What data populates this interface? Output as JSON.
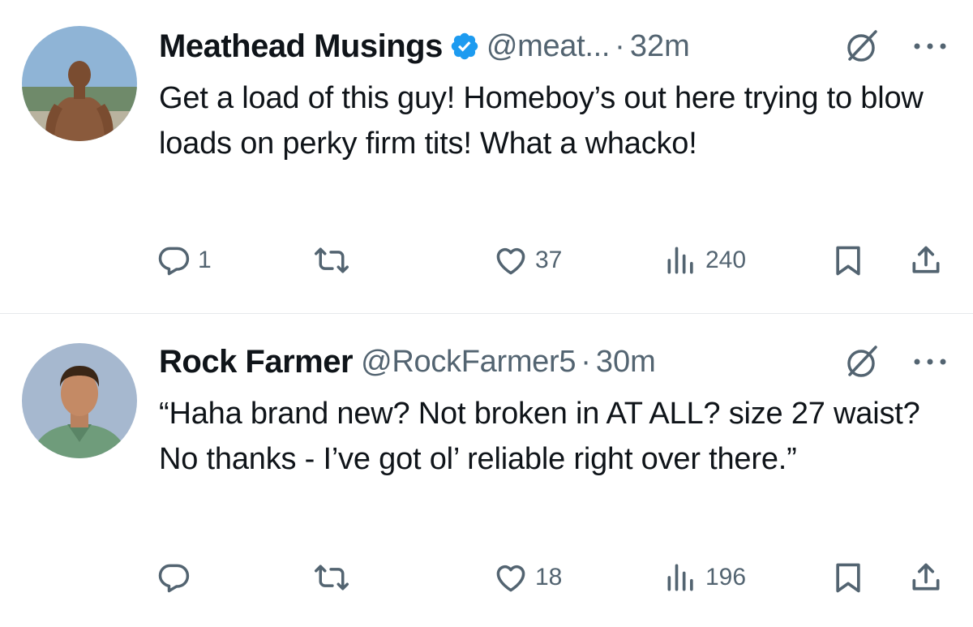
{
  "tweets": [
    {
      "name": "Meathead Musings",
      "verified": true,
      "handle": "@meat...",
      "dot": "·",
      "time": "32m",
      "text": "Get a load of this guy! Homeboy’s out here trying to blow loads on perky firm tits! What a whacko!",
      "replies": "1",
      "reposts": "",
      "likes": "37",
      "views": "240"
    },
    {
      "name": "Rock Farmer",
      "verified": false,
      "handle": "@RockFarmer5",
      "dot": "·",
      "time": "30m",
      "text": "“Haha brand new? Not broken in AT ALL? size 27 waist? No thanks - I’ve got ol’ reliable right over there.”",
      "replies": "",
      "reposts": "",
      "likes": "18",
      "views": "196"
    }
  ],
  "colors": {
    "text": "#0f1419",
    "secondary": "#536471",
    "verified": "#1d9bf0",
    "divider": "#e6e9ec"
  },
  "icons": [
    "reply-icon",
    "repost-icon",
    "like-icon",
    "views-icon",
    "bookmark-icon",
    "share-icon",
    "grok-icon",
    "more-icon",
    "verified-badge-icon"
  ]
}
